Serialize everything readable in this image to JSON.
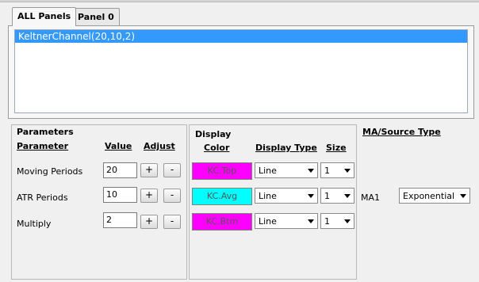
{
  "tabs": [
    {
      "label": "ALL Panels",
      "active": true
    },
    {
      "label": "Panel 0",
      "active": false
    }
  ],
  "indicator_list": {
    "items": [
      "KeltnerChannel(20,10,2)"
    ],
    "selected_index": 0
  },
  "parameters": {
    "title": "Parameters",
    "headers": {
      "parameter": "Parameter",
      "value": "Value",
      "adjust": "Adjust"
    },
    "rows": [
      {
        "label": "Moving Periods",
        "value": "20",
        "plus": "+",
        "minus": "-"
      },
      {
        "label": "ATR Periods",
        "value": "10",
        "plus": "+",
        "minus": "-"
      },
      {
        "label": "Multiply",
        "value": "2",
        "plus": "+",
        "minus": "-"
      }
    ]
  },
  "display": {
    "title": "Display",
    "headers": {
      "color": "Color",
      "display_type": "Display Type",
      "size": "Size"
    },
    "rows": [
      {
        "color_label": "KC.Top",
        "color": "#ff00ff",
        "display_type": "Line",
        "size": "1"
      },
      {
        "color_label": "KC.Avg",
        "color": "#00ffff",
        "display_type": "Line",
        "size": "1"
      },
      {
        "color_label": "KC.Btm",
        "color": "#ff00ff",
        "display_type": "Line",
        "size": "1"
      }
    ]
  },
  "ma_source": {
    "title": "MA/Source Type",
    "label": "MA1",
    "value": "Exponential"
  },
  "colors": {
    "selection": "#3399ff",
    "background": "#f0f0f0"
  }
}
